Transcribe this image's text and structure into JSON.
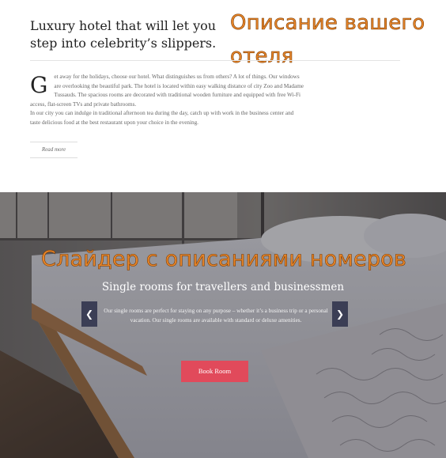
{
  "about": {
    "title": "Luxury hotel that will let you step into celebrity’s slippers.",
    "annotation": "Описание вашего отеля",
    "dropcap": "G",
    "paragraph1": "et away for the holidays, choose our hotel. What distinguishes us from others? A lot of things. Our windows are overlooking the beautiful park. The hotel is located within easy walking distance of city Zoo and Madame Tussauds. The spacious rooms are decorated with traditional wooden furniture and equipped with free Wi-Fi access, flat-screen TVs and private bathrooms.",
    "paragraph2": "In our city you can indulge in traditional afternoon tea during the day, catch up with work in the business center and taste delicious food at the best restaurant upon your choice in the evening.",
    "read_more": "Read more"
  },
  "slider": {
    "annotation": "Слайдер с описаниями номеров",
    "title": "Single rooms for travellers and businessmen",
    "description": "Our single rooms are perfect for staying on any purpose – whether it’s a business trip or a personal vacation. Our single rooms are available with standard or deluxe amenities.",
    "prev_icon": "chevron-left-icon",
    "next_icon": "chevron-right-icon",
    "prev_glyph": "❮",
    "next_glyph": "❯",
    "book_label": "Book Room"
  },
  "colors": {
    "annotation": "#e8862a",
    "button": "#e14a5b",
    "arrow_bg": "#3b3e55"
  }
}
